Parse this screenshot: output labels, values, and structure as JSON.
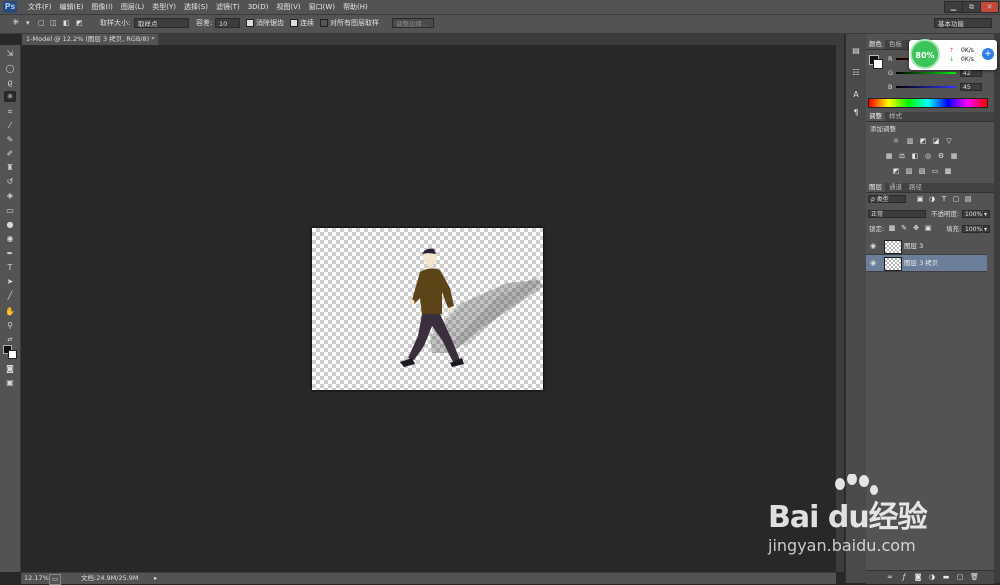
{
  "app": {
    "logo": "Ps"
  },
  "menu": [
    "文件(F)",
    "编辑(E)",
    "图像(I)",
    "图层(L)",
    "类型(Y)",
    "选择(S)",
    "滤镜(T)",
    "3D(D)",
    "视图(V)",
    "窗口(W)",
    "帮助(H)"
  ],
  "window_controls": [
    "▁",
    "⧉",
    "✕"
  ],
  "options": {
    "sample_size_label": "取样大小:",
    "sample_size_value": "取样点",
    "tolerance_label": "容差:",
    "tolerance_value": "10",
    "antialias_label": "消除锯齿",
    "contiguous_label": "连续",
    "sample_all_label": "对所有图层取样",
    "refine_edge_label": "调整边缘...",
    "workspace_label": "基本功能"
  },
  "document_tab": {
    "title": "1-Model @ 12.2% (图层 3 拷贝, RGB/8) *",
    "close": "×"
  },
  "toolbar_icons": [
    "move-icon",
    "marquee-icon",
    "lasso-icon",
    "magic-wand-icon",
    "crop-icon",
    "eyedropper-icon",
    "healing-brush-icon",
    "brush-icon",
    "clone-stamp-icon",
    "history-brush-icon",
    "eraser-icon",
    "gradient-icon",
    "blur-icon",
    "dodge-icon",
    "pen-icon",
    "type-icon",
    "path-selection-icon",
    "line-icon",
    "hand-icon",
    "zoom-icon",
    "swap-colors-icon",
    "color-swatch-icon",
    "quick-mask-icon",
    "screen-mode-icon"
  ],
  "status": {
    "zoom": "12.17%",
    "doc": "文档:24.9M/25.9M"
  },
  "color_panel": {
    "tabs": [
      "颜色",
      "色板"
    ],
    "r": {
      "label": "R",
      "value": ""
    },
    "g": {
      "label": "G",
      "value": "42"
    },
    "b": {
      "label": "B",
      "value": "45"
    }
  },
  "adjust_panel": {
    "tabs": [
      "调整",
      "样式"
    ],
    "title": "添加调整"
  },
  "layers_panel": {
    "tabs": [
      "图层",
      "通道",
      "路径"
    ],
    "filter": "ρ 类型",
    "blend_mode": "正常",
    "opacity_label": "不透明度:",
    "opacity_value": "100%",
    "lock_label": "锁定:",
    "fill_label": "填充:",
    "fill_value": "100%",
    "layers": [
      {
        "name": "图层 3",
        "selected": false
      },
      {
        "name": "图层 3 拷贝",
        "selected": true
      }
    ]
  },
  "speed_widget": {
    "percent": "80%",
    "up": "0K/s",
    "down": "0K/s",
    "plus": "+"
  },
  "watermark": {
    "brand": "Bai du经验",
    "url": "jingyan.baidu.com"
  },
  "colors": {
    "selection": "#6c7e99",
    "accent_green": "#3cc45a"
  }
}
